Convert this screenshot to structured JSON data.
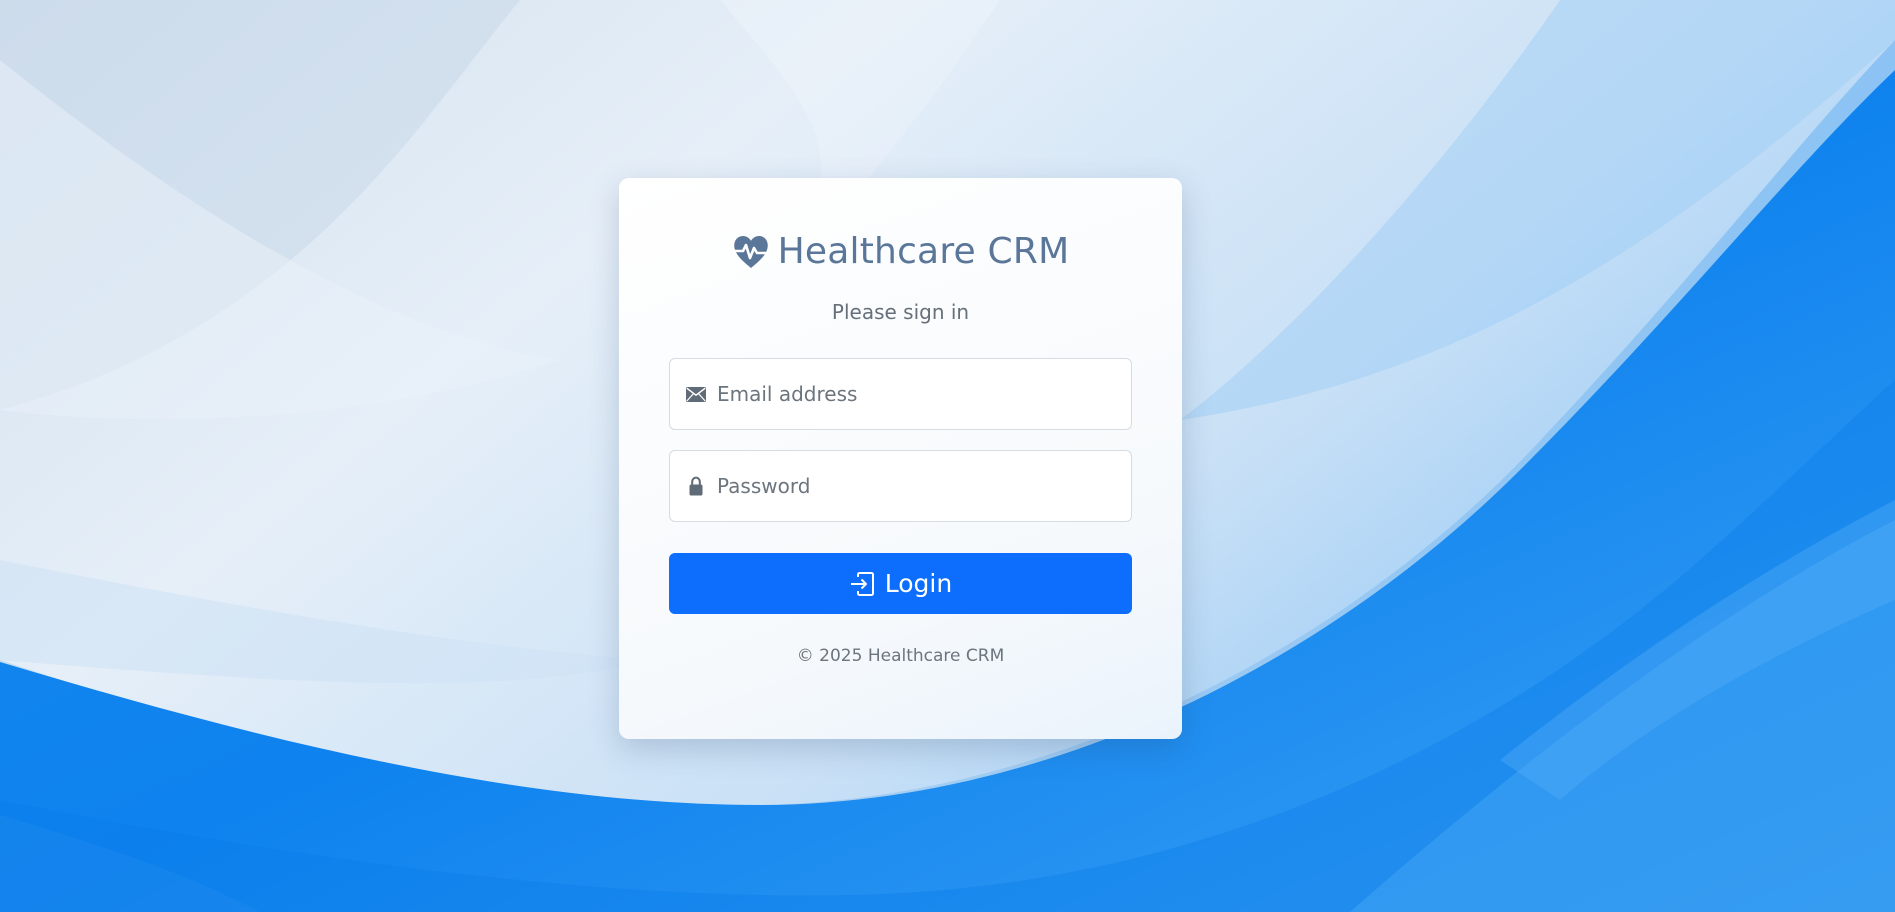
{
  "brand": {
    "title": "Healthcare CRM",
    "icon": "heart-pulse-icon"
  },
  "login_form": {
    "subtitle": "Please sign in",
    "email": {
      "value": "",
      "placeholder": "Email address",
      "icon": "envelope-icon"
    },
    "password": {
      "value": "",
      "placeholder": "Password",
      "icon": "lock-icon"
    },
    "login_button": {
      "label": "Login",
      "icon": "box-arrow-in-right-icon"
    },
    "footer": "© 2025 Healthcare CRM"
  },
  "colors": {
    "brand_text": "#5a7699",
    "primary": "#0d6efd",
    "muted_text": "#6c757d",
    "background_light": "#dbe7f3",
    "background_blue": "#1284f0"
  }
}
